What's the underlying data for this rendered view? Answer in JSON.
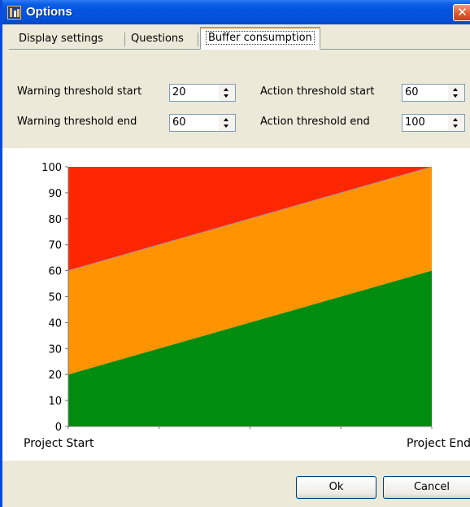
{
  "window": {
    "title": "Options",
    "close_glyph": "✕",
    "icon": "app-logo-icon"
  },
  "tabs": [
    {
      "label": "Display settings",
      "selected": false
    },
    {
      "label": "Questions",
      "selected": false
    },
    {
      "label": "Buffer consumption",
      "selected": true
    }
  ],
  "fields": {
    "warning_start": {
      "label": "Warning threshold start",
      "value": "20"
    },
    "warning_end": {
      "label": "Warning threshold end",
      "value": "60"
    },
    "action_start": {
      "label": "Action threshold start",
      "value": "60"
    },
    "action_end": {
      "label": "Action threshold end",
      "value": "100"
    }
  },
  "buttons": {
    "ok": "Ok",
    "cancel": "Cancel"
  },
  "colors": {
    "green": "#008c0f",
    "orange": "#ff9300",
    "red": "#ff2600",
    "title_blue": "#0553de"
  },
  "chart_data": {
    "type": "area",
    "categories": [
      "Project Start",
      "Project End"
    ],
    "x_tick_labels": [
      "Project Start",
      "Project End"
    ],
    "y_ticks": [
      "0",
      "10",
      "20",
      "30",
      "40",
      "50",
      "60",
      "70",
      "80",
      "90",
      "100"
    ],
    "ylim": [
      0,
      100
    ],
    "series": [
      {
        "values": [
          20,
          60
        ],
        "color": "#008c0f"
      },
      {
        "values": [
          60,
          100
        ],
        "color": "#ff9300"
      },
      {
        "values": [
          100,
          100
        ],
        "color": "#ff2600"
      }
    ],
    "legend": "none",
    "grid": false
  }
}
